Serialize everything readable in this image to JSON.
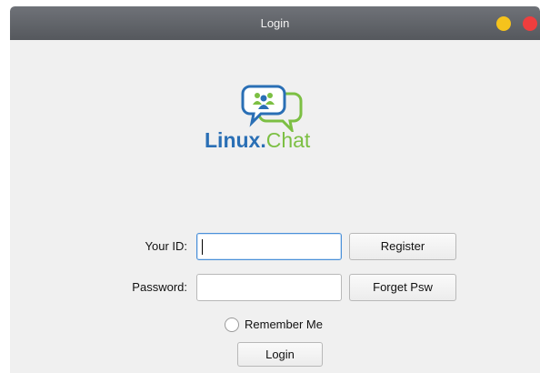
{
  "window": {
    "title": "Login"
  },
  "logo": {
    "brand_part1": "Linux",
    "brand_dot": ".",
    "brand_part2": "Chat"
  },
  "form": {
    "id_label": "Your ID:",
    "id_value": "",
    "password_label": "Password:",
    "password_value": "",
    "register_label": "Register",
    "forget_label": "Forget Psw",
    "remember_label": "Remember Me",
    "remember_checked": false,
    "login_label": "Login"
  },
  "colors": {
    "titlebar": "#5c5f64",
    "minimize": "#f5c31c",
    "close": "#ef3e3e",
    "brand_blue": "#2a6fb5",
    "brand_green": "#7cbf43"
  },
  "icons": [
    "minimize-icon",
    "close-icon",
    "chat-bubbles-logo-icon"
  ]
}
